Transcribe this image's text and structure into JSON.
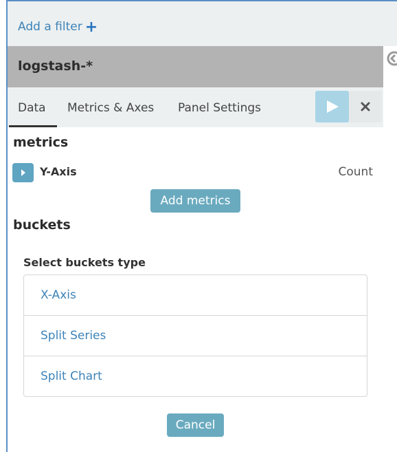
{
  "filter_bar": {
    "add_filter_label": "Add a filter",
    "plus_glyph": "+"
  },
  "index": {
    "title": "logstash-*"
  },
  "tabs": [
    {
      "label": "Data",
      "active": true
    },
    {
      "label": "Metrics & Axes",
      "active": false
    },
    {
      "label": "Panel Settings",
      "active": false
    }
  ],
  "metrics": {
    "section_title": "metrics",
    "y_axis": {
      "label": "Y-Axis",
      "value": "Count"
    },
    "add_metrics_label": "Add metrics"
  },
  "buckets": {
    "section_title": "buckets",
    "select_label": "Select buckets type",
    "options": [
      {
        "label": "X-Axis"
      },
      {
        "label": "Split Series"
      },
      {
        "label": "Split Chart"
      }
    ],
    "cancel_label": "Cancel"
  },
  "icons": {
    "add_filter": "plus-icon",
    "apply": "play-icon",
    "discard": "close-icon",
    "collapse": "chevron-left-icon",
    "y_axis_toggle": "chevron-right-icon"
  },
  "colors": {
    "link": "#3d83b8",
    "primary_button": "#6aaabf",
    "apply_button": "#a9d4e6",
    "header_bg": "#b3b3b3",
    "bar_bg": "#ecf0f1"
  }
}
